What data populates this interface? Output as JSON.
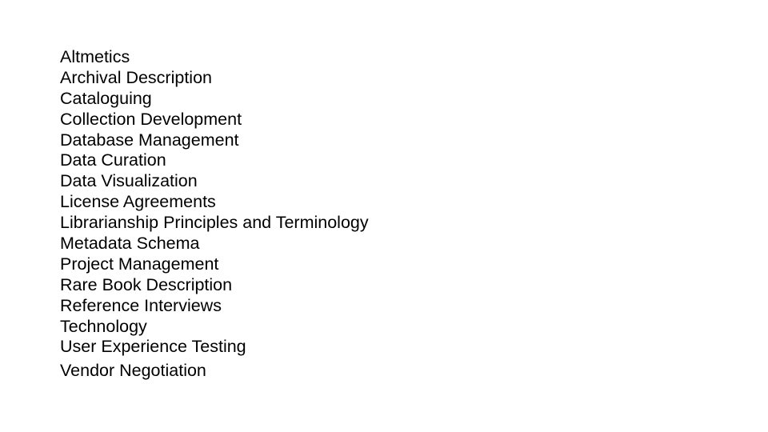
{
  "slide": {
    "items": [
      "Altmetics",
      "Archival Description",
      "Cataloguing",
      "Collection Development",
      "Database Management",
      "Data Curation",
      "Data Visualization",
      "License Agreements",
      "Librarianship Principles and Terminology",
      "Metadata Schema",
      "Project Management",
      "Rare Book Description",
      "Reference Interviews",
      "Technology",
      "User Experience Testing",
      "Vendor Negotiation"
    ]
  }
}
